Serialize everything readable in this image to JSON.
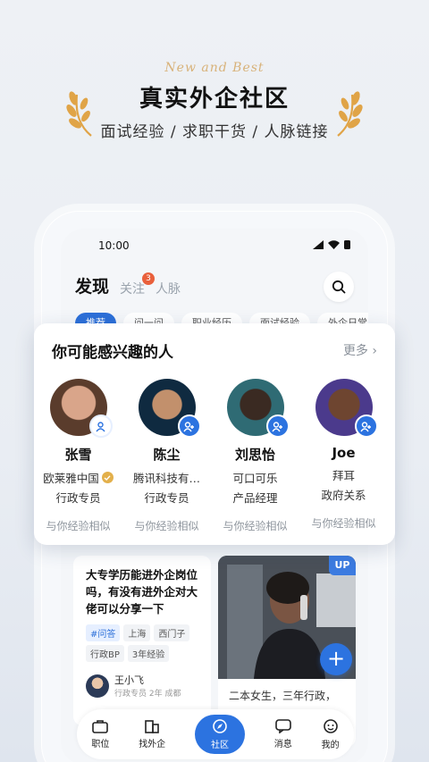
{
  "hero": {
    "script": "New and Best",
    "title": "真实外企社区",
    "subtitle": "面试经验 / 求职干货 / 人脉链接"
  },
  "status_bar": {
    "time": "10:00"
  },
  "header": {
    "tabs": [
      {
        "label": "发现",
        "active": true
      },
      {
        "label": "关注",
        "badge": "3"
      },
      {
        "label": "人脉"
      }
    ]
  },
  "chips": [
    "推荐",
    "问一问",
    "职业经历",
    "面试经验",
    "外企日常"
  ],
  "suggest": {
    "title": "你可能感兴趣的人",
    "more": "更多",
    "people": [
      {
        "name": "张雪",
        "company": "欧莱雅中国",
        "verified": true,
        "title": "行政专员",
        "similarity": "与你经验相似",
        "added": true
      },
      {
        "name": "陈尘",
        "company": "腾讯科技有…",
        "verified": false,
        "title": "行政专员",
        "similarity": "与你经验相似",
        "added": false
      },
      {
        "name": "刘思怡",
        "company": "可口可乐",
        "verified": false,
        "title": "产品经理",
        "similarity": "与你经验相似",
        "added": false
      },
      {
        "name": "Joe",
        "company": "拜耳",
        "verified": false,
        "title": "政府关系",
        "similarity": "与你经验相似",
        "added": false
      }
    ]
  },
  "feed": {
    "left": {
      "question": "大专学历能进外企岗位吗，有没有进外企对大佬可以分享一下",
      "tags": [
        "#问答",
        "上海",
        "西门子",
        "行政BP",
        "3年经验"
      ],
      "author": "王小飞",
      "author_meta": "行政专员 2年 成都"
    },
    "right": {
      "badge": "UP",
      "text": "二本女生，三年行政，"
    }
  },
  "nav": [
    {
      "label": "职位",
      "icon": "briefcase-icon"
    },
    {
      "label": "找外企",
      "icon": "building-icon"
    },
    {
      "label": "社区",
      "icon": "compass-icon",
      "active": true
    },
    {
      "label": "消息",
      "icon": "chat-icon"
    },
    {
      "label": "我的",
      "icon": "profile-icon"
    }
  ],
  "colors": {
    "accent": "#2c73e0",
    "gold": "#d8b27a",
    "badge": "#e9603c"
  }
}
